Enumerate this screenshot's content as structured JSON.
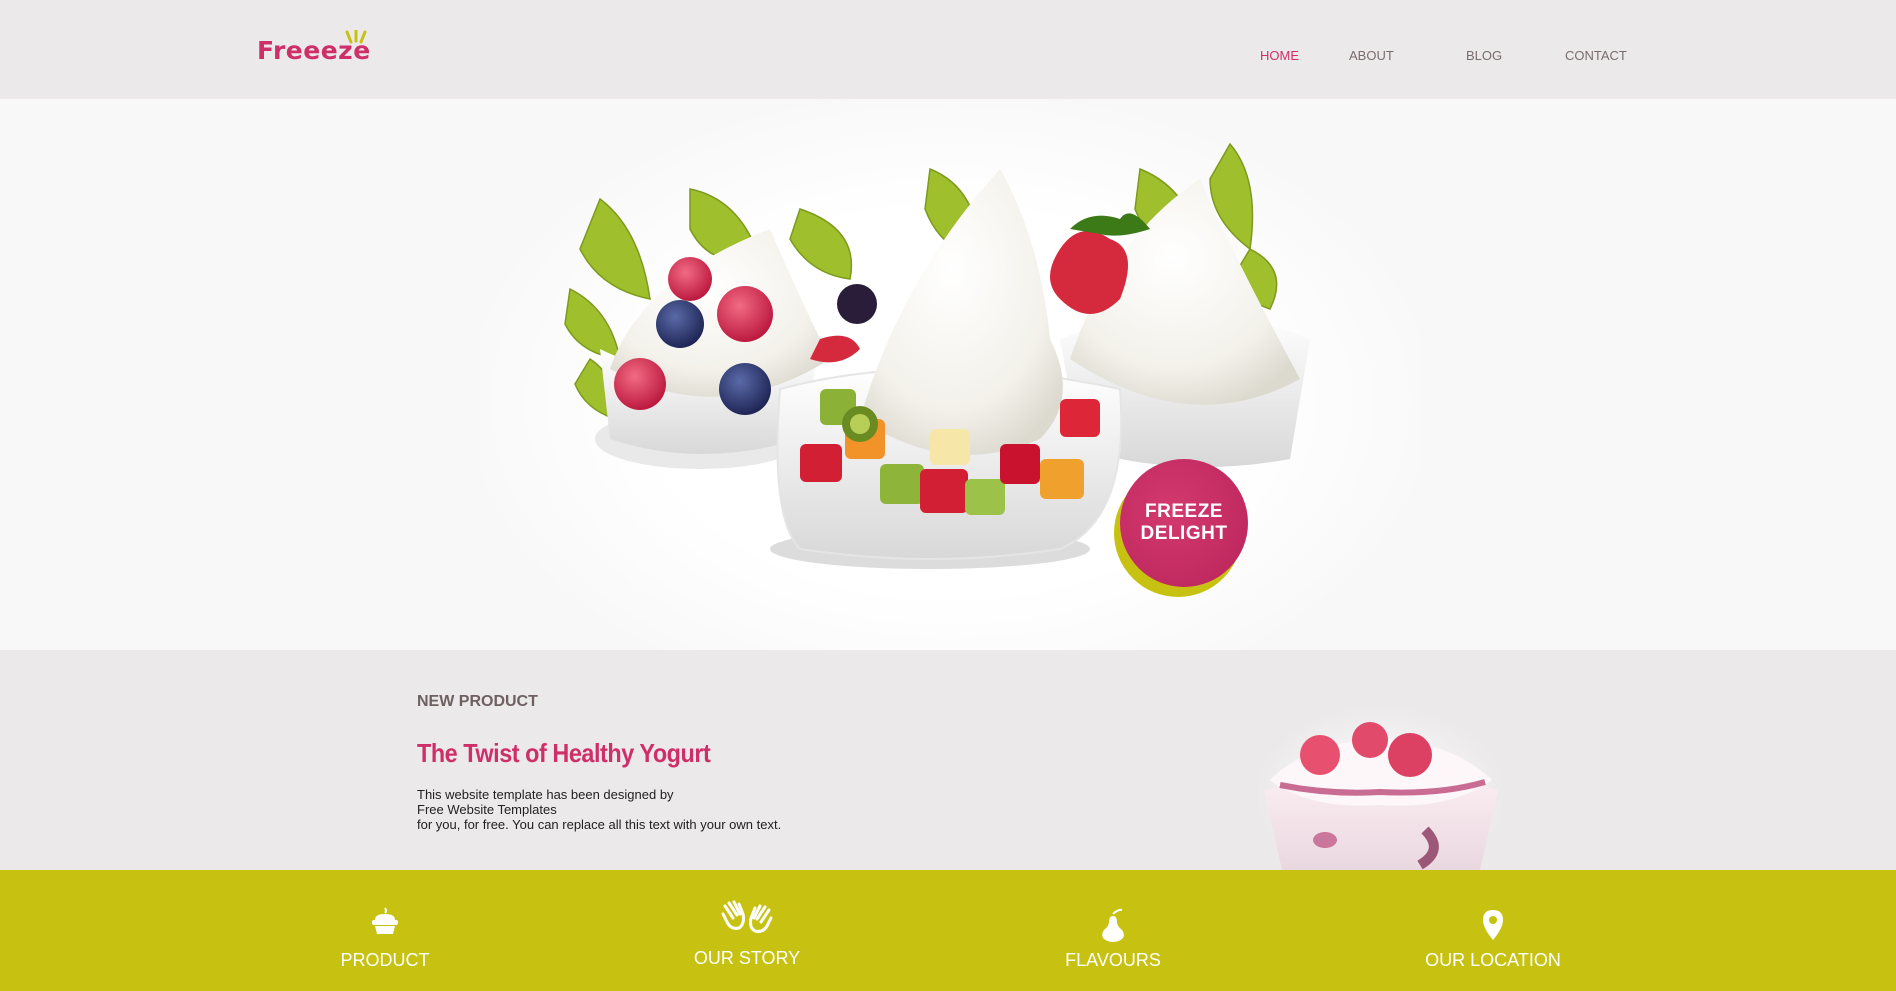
{
  "brand": {
    "logo_text": "Freeeze",
    "accent": "#cf2f68",
    "lime": "#c7c211"
  },
  "nav": {
    "items": [
      {
        "label": "HOME",
        "active": true
      },
      {
        "label": "ABOUT",
        "active": false
      },
      {
        "label": "BLOG",
        "active": false
      },
      {
        "label": "CONTACT",
        "active": false
      }
    ]
  },
  "hero": {
    "badge_line1": "FREEZE",
    "badge_line2": "DELIGHT"
  },
  "new_product": {
    "label": "NEW PRODUCT",
    "title": "The Twist of Healthy Yogurt",
    "text_line1": "This website template has been designed by",
    "text_line2": "Free Website Templates",
    "text_line3": "for you, for free. You can replace all this text with your own text."
  },
  "features": [
    {
      "label": "PRODUCT",
      "icon": "cupcake-icon"
    },
    {
      "label": "OUR STORY",
      "icon": "hands-icon"
    },
    {
      "label": "FLAVOURS",
      "icon": "pear-icon"
    },
    {
      "label": "OUR LOCATION",
      "icon": "map-pin-icon"
    }
  ]
}
